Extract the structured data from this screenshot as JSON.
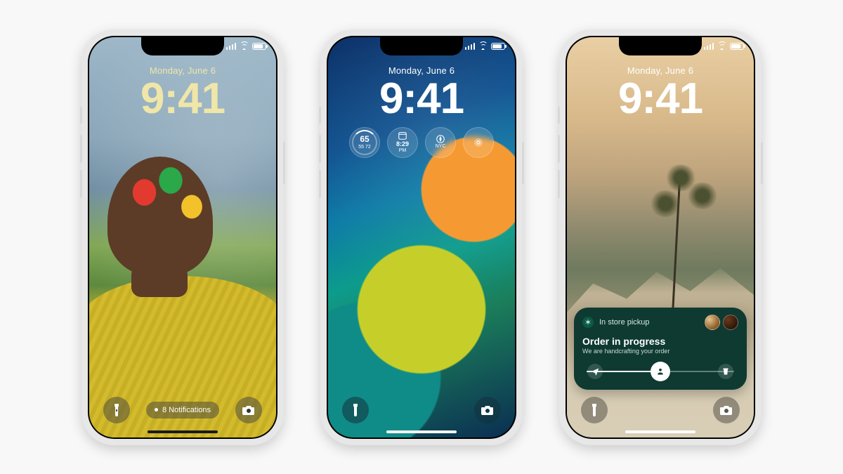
{
  "phones": {
    "a": {
      "date": "Monday, June 6",
      "time": "9:41",
      "notifications": "8 Notifications"
    },
    "b": {
      "date": "Monday, June 6",
      "time": "9:41",
      "widgets": {
        "weather": {
          "temp": "65",
          "low": "55",
          "high": "72"
        },
        "calendar": {
          "time": "8:29",
          "suffix": "PM"
        },
        "clock": {
          "label": "NYC"
        }
      }
    },
    "c": {
      "date": "Monday, June 6",
      "time": "9:41",
      "live": {
        "merchant": "In store pickup",
        "title": "Order in progress",
        "subtitle": "We are handcrafting your order"
      }
    }
  }
}
